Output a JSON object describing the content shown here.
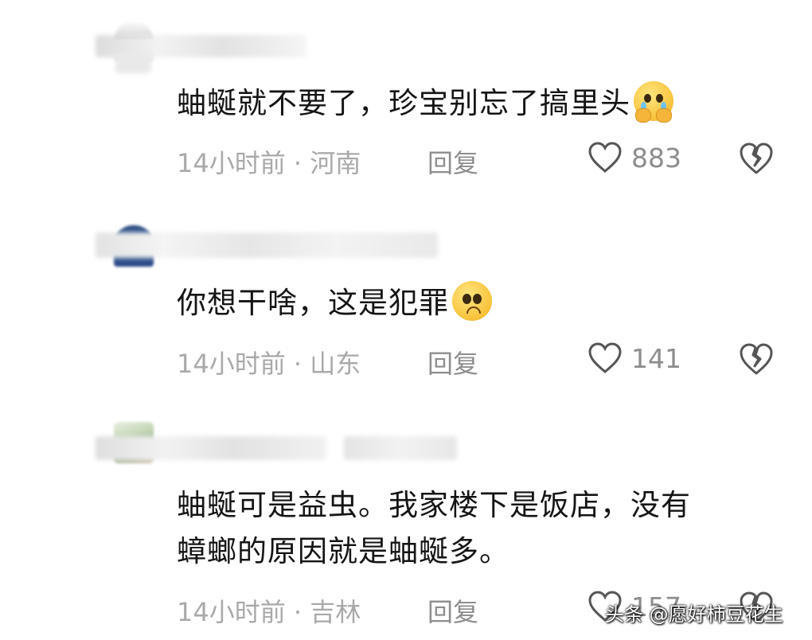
{
  "comments": [
    {
      "text": "蚰蜒就不要了，珍宝别忘了搞里头",
      "emoji": "crying-pleading-emoji",
      "meta": "14小时前 · 河南",
      "reply": "回复",
      "likes": "883"
    },
    {
      "text": "你想干啥，这是犯罪",
      "emoji": "pleading-emoji",
      "meta": "14小时前 · 山东",
      "reply": "回复",
      "likes": "141"
    },
    {
      "text_line1": "蚰蜒可是益虫。我家楼下是饭店，没有",
      "text_line2": "蟑螂的原因就是蚰蜒多。",
      "meta": "14小时前 · 吉林",
      "reply": "回复",
      "likes": "157"
    }
  ],
  "watermark": "头条 @愿好柿豆花生",
  "colors": {
    "text": "#141414",
    "meta": "#a9a9a9",
    "icon": "#555555"
  }
}
